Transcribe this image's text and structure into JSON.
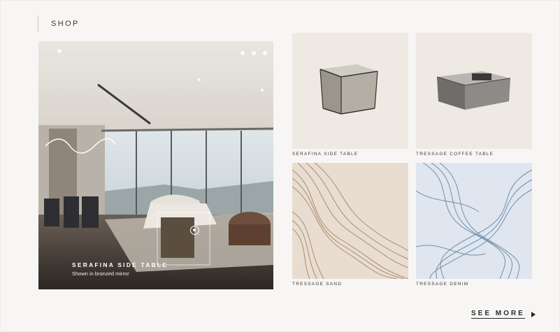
{
  "section": {
    "title": "SHOP"
  },
  "hero": {
    "title": "SERAFINA SIDE TABLE",
    "subtitle": "Shown in bronzed mirror"
  },
  "products": [
    {
      "name": "SERAFINA SIDE TABLE"
    },
    {
      "name": "TRESSAGE COFFEE TABLE"
    },
    {
      "name": "TRESSAGE SAND"
    },
    {
      "name": "TRESSAGE DENIM"
    }
  ],
  "footer": {
    "see_more": "SEE MORE"
  },
  "colors": {
    "background": "#f7f6f4",
    "tile_bg": "#efe9e3",
    "sand": "#e8ddd0",
    "denim": "#dfe6ef"
  }
}
